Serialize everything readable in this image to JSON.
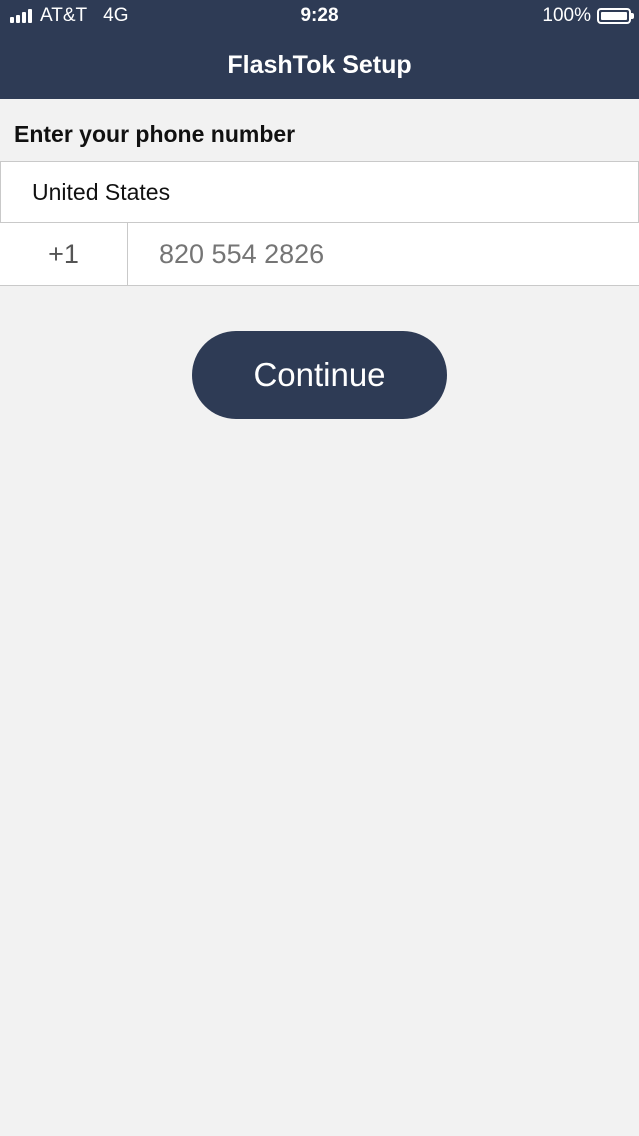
{
  "status_bar": {
    "carrier": "AT&T",
    "network": "4G",
    "time": "9:28",
    "battery_percent": "100%",
    "battery_level": 1.0,
    "signal_bars": 4,
    "icons": [
      "signal-bars-icon",
      "battery-icon"
    ]
  },
  "nav": {
    "title": "FlashTok Setup"
  },
  "form": {
    "prompt": "Enter your phone number",
    "country": "United States",
    "country_code": "+1",
    "phone_placeholder": "820 554 2826"
  },
  "actions": {
    "continue_label": "Continue"
  },
  "colors": {
    "header_bg": "#2e3b55",
    "page_bg": "#f2f2f2",
    "button_bg": "#2e3b55",
    "field_bg": "#ffffff",
    "border": "#c9c9c9"
  }
}
